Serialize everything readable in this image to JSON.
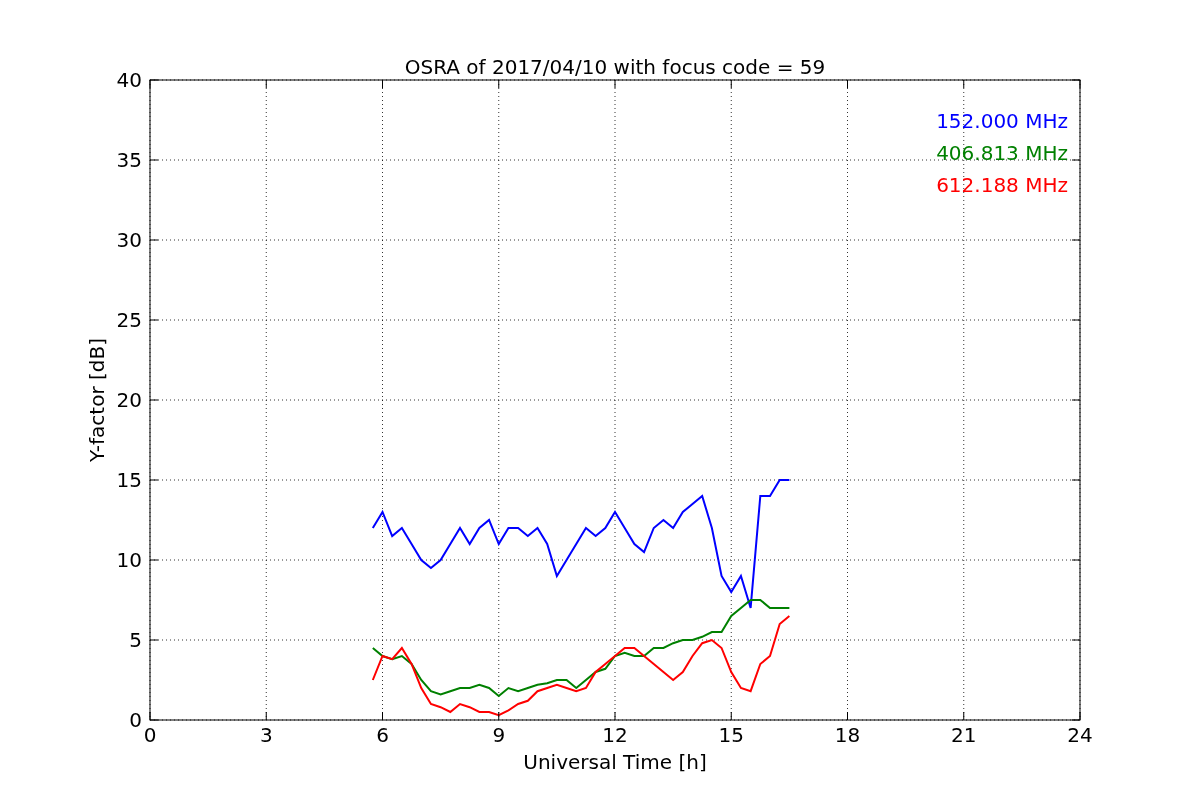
{
  "chart": {
    "chart_data": {
      "type": "line",
      "title": "OSRA of 2017/04/10 with focus code = 59",
      "xlabel": "Universal Time [h]",
      "ylabel": "Y-factor [dB]",
      "x": [
        5.75,
        6,
        6.25,
        6.5,
        6.75,
        7,
        7.25,
        7.5,
        7.75,
        8,
        8.25,
        8.5,
        8.75,
        9,
        9.25,
        9.5,
        9.75,
        10,
        10.25,
        10.5,
        10.75,
        11,
        11.25,
        11.5,
        11.75,
        12,
        12.25,
        12.5,
        12.75,
        13,
        13.25,
        13.5,
        13.75,
        14,
        14.25,
        14.5,
        14.75,
        15,
        15.25,
        15.5,
        15.75,
        16,
        16.25,
        16.5
      ],
      "series": [
        {
          "name": "152.000 MHz",
          "color": "#0000ff",
          "values": [
            12,
            13,
            11.5,
            12,
            11,
            10,
            9.5,
            10,
            11,
            12,
            11,
            12,
            12.5,
            11,
            12,
            12,
            11.5,
            12,
            11,
            9,
            10,
            11,
            12,
            11.5,
            12,
            13,
            12,
            11,
            10.5,
            12,
            12.5,
            12,
            13,
            13.5,
            14,
            12,
            9,
            8,
            9,
            7,
            14,
            14,
            15,
            15
          ]
        },
        {
          "name": "406.813 MHz",
          "color": "#008000",
          "values": [
            4.5,
            4,
            3.8,
            4,
            3.5,
            2.5,
            1.8,
            1.6,
            1.8,
            2,
            2,
            2.2,
            2,
            1.5,
            2,
            1.8,
            2,
            2.2,
            2.3,
            2.5,
            2.5,
            2,
            2.5,
            3,
            3.2,
            4,
            4.2,
            4,
            4,
            4.5,
            4.5,
            4.8,
            5,
            5,
            5.2,
            5.5,
            5.5,
            6.5,
            7,
            7.5,
            7.5,
            7,
            7,
            7
          ]
        },
        {
          "name": "612.188 MHz",
          "color": "#ff0000",
          "values": [
            2.5,
            4,
            3.8,
            4.5,
            3.5,
            2,
            1,
            0.8,
            0.5,
            1,
            0.8,
            0.5,
            0.5,
            0.3,
            0.6,
            1,
            1.2,
            1.8,
            2,
            2.2,
            2,
            1.8,
            2,
            3,
            3.5,
            4,
            4.5,
            4.5,
            4,
            3.5,
            3,
            2.5,
            3,
            4,
            4.8,
            5,
            4.5,
            3,
            2,
            1.8,
            3.5,
            4,
            6,
            6.5
          ]
        }
      ],
      "xlim": [
        0,
        24
      ],
      "ylim": [
        0,
        40
      ],
      "xticks": [
        0,
        3,
        6,
        9,
        12,
        15,
        18,
        21,
        24
      ],
      "yticks": [
        0,
        5,
        10,
        15,
        20,
        25,
        30,
        35,
        40
      ],
      "grid": true
    }
  }
}
